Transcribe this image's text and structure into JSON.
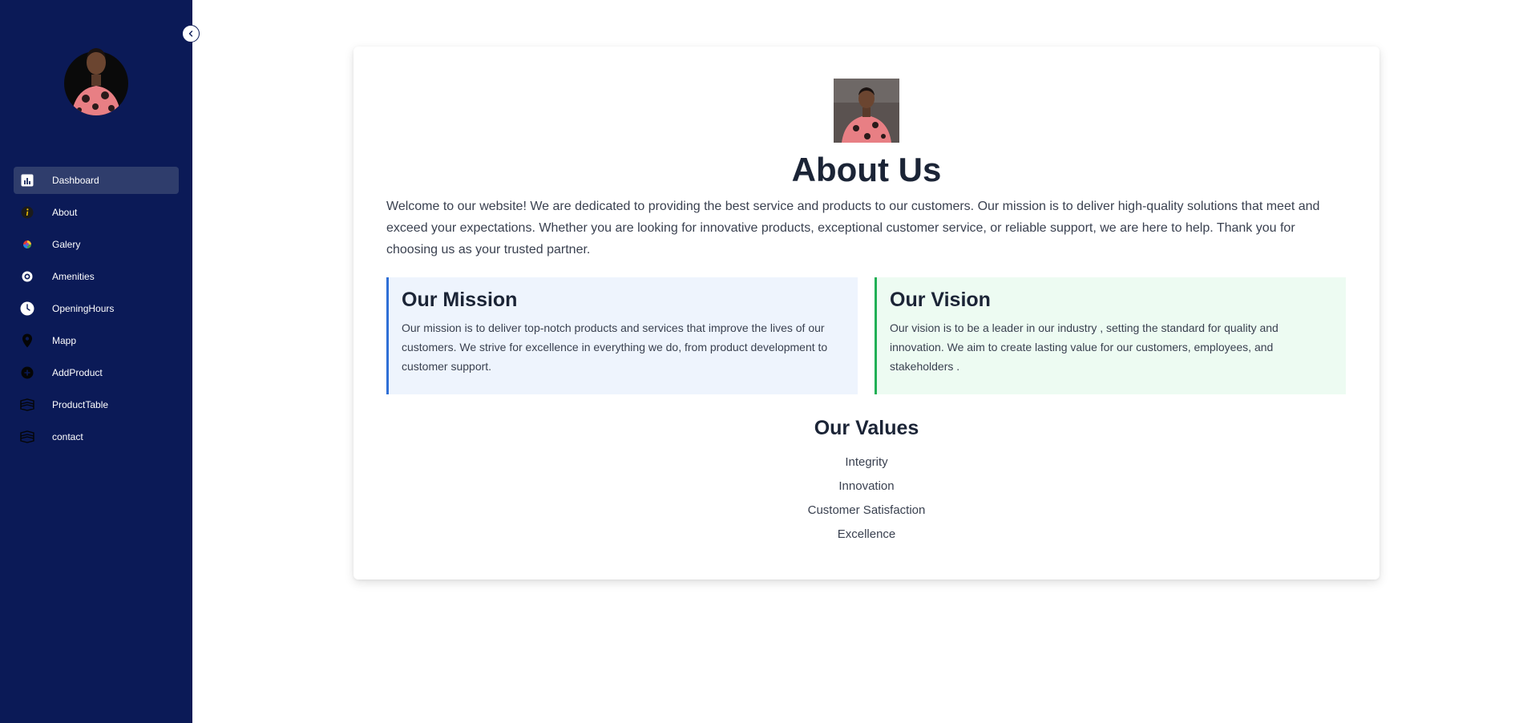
{
  "sidebar": {
    "items": [
      {
        "label": "Dashboard",
        "icon": "chart-bar-icon",
        "active": true
      },
      {
        "label": "About",
        "icon": "info-icon"
      },
      {
        "label": "Galery",
        "icon": "gallery-icon"
      },
      {
        "label": "Amenities",
        "icon": "settings-icon"
      },
      {
        "label": "OpeningHours",
        "icon": "clock-icon"
      },
      {
        "label": "Mapp",
        "icon": "map-pin-icon"
      },
      {
        "label": "AddProduct",
        "icon": "plus-circle-icon"
      },
      {
        "label": "ProductTable",
        "icon": "table-icon"
      },
      {
        "label": "contact",
        "icon": "contact-icon"
      }
    ]
  },
  "about": {
    "title": "About Us",
    "intro": "Welcome to our website! We are dedicated to providing the best service and products to our customers. Our mission is to deliver high-quality solutions that meet and exceed your expectations. Whether you are looking for innovative products, exceptional customer service, or reliable support, we are here to help. Thank you for choosing us as your trusted partner.",
    "mission": {
      "title": "Our Mission",
      "text": "Our mission is to deliver top-notch products and services that improve the lives of our customers. We strive for excellence in everything we do, from product development to customer support."
    },
    "vision": {
      "title": "Our Vision",
      "text": "Our vision is to be a leader in our industry , setting the standard for quality and innovation. We aim to create lasting value for our customers, employees, and stakeholders ."
    },
    "values": {
      "title": "Our Values",
      "items": [
        "Integrity",
        "Innovation",
        "Customer Satisfaction",
        "Excellence"
      ]
    }
  },
  "colors": {
    "sidebar_bg": "#0b1a57",
    "active_item_bg": "#2f3d6c",
    "mission_accent": "#2f6fd6",
    "vision_accent": "#20b055"
  }
}
